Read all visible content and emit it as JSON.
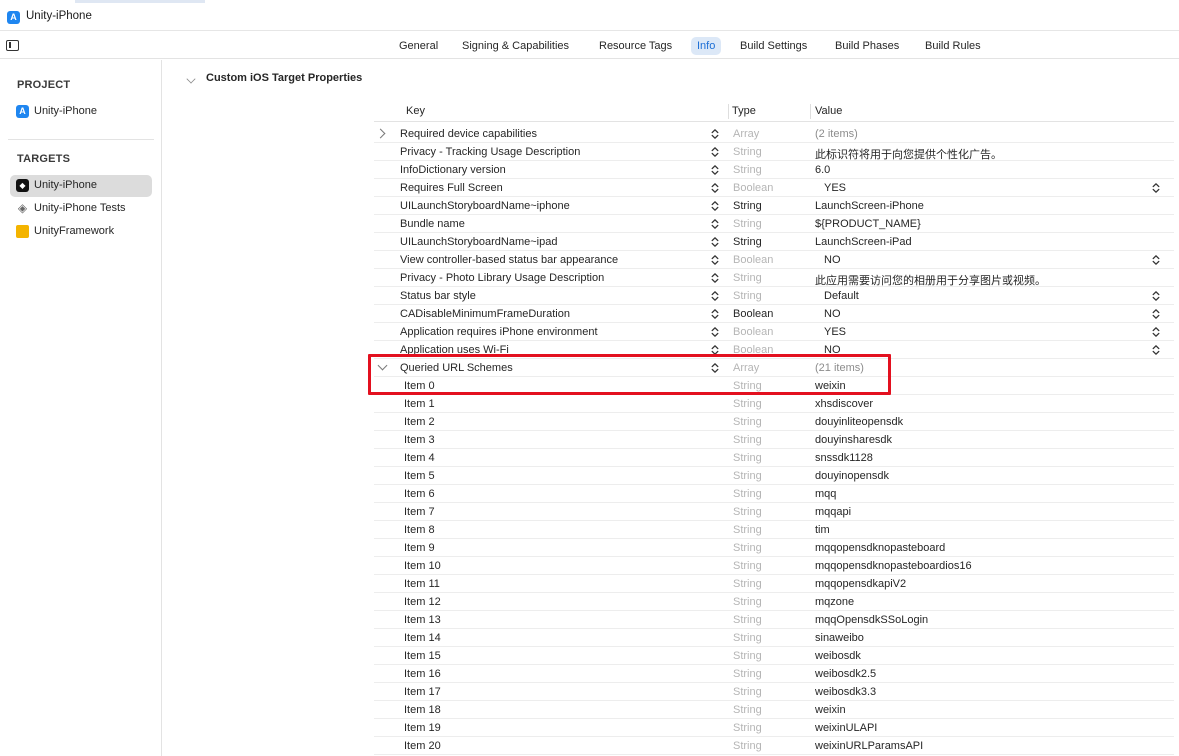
{
  "window": {
    "title": "Unity-iPhone"
  },
  "tabs": [
    {
      "label": "General"
    },
    {
      "label": "Signing & Capabilities"
    },
    {
      "label": "Resource Tags"
    },
    {
      "label": "Info",
      "active": true
    },
    {
      "label": "Build Settings"
    },
    {
      "label": "Build Phases"
    },
    {
      "label": "Build Rules"
    }
  ],
  "sidebar": {
    "project_header": "PROJECT",
    "project_item": "Unity-iPhone",
    "targets_header": "TARGETS",
    "targets": [
      {
        "label": "Unity-iPhone",
        "icon": "unity-app-icon",
        "selected": true
      },
      {
        "label": "Unity-iPhone Tests",
        "icon": "test-bundle-icon"
      },
      {
        "label": "UnityFramework",
        "icon": "framework-icon"
      }
    ]
  },
  "section": {
    "title": "Custom iOS Target Properties"
  },
  "table": {
    "headers": {
      "key": "Key",
      "type": "Type",
      "value": "Value"
    },
    "rows": [
      {
        "key": "Required device capabilities",
        "type": "Array",
        "value": "(2 items)",
        "disclosure": "closed",
        "type_dim": true,
        "value_dim": true
      },
      {
        "key": "Privacy - Tracking Usage Description",
        "type": "String",
        "value": "此标识符将用于向您提供个性化广告。",
        "type_dim": true
      },
      {
        "key": "InfoDictionary version",
        "type": "String",
        "value": "6.0",
        "type_dim": true
      },
      {
        "key": "Requires Full Screen",
        "type": "Boolean",
        "value": "YES",
        "type_dim": true,
        "popup": true
      },
      {
        "key": "UILaunchStoryboardName~iphone",
        "type": "String",
        "value": "LaunchScreen-iPhone",
        "type_dim": false
      },
      {
        "key": "Bundle name",
        "type": "String",
        "value": "${PRODUCT_NAME}",
        "type_dim": true
      },
      {
        "key": "UILaunchStoryboardName~ipad",
        "type": "String",
        "value": "LaunchScreen-iPad",
        "type_dim": false
      },
      {
        "key": "View controller-based status bar appearance",
        "type": "Boolean",
        "value": "NO",
        "type_dim": true,
        "popup": true
      },
      {
        "key": "Privacy - Photo Library Usage Description",
        "type": "String",
        "value": "此应用需要访问您的相册用于分享图片或视频。",
        "type_dim": true
      },
      {
        "key": "Status bar style",
        "type": "String",
        "value": "Default",
        "type_dim": true,
        "popup": true
      },
      {
        "key": "CADisableMinimumFrameDuration",
        "type": "Boolean",
        "value": "NO",
        "type_dim": false,
        "popup": true
      },
      {
        "key": "Application requires iPhone environment",
        "type": "Boolean",
        "value": "YES",
        "type_dim": true,
        "popup": true
      },
      {
        "key": "Application uses Wi-Fi",
        "type": "Boolean",
        "value": "NO",
        "type_dim": true,
        "popup": true
      },
      {
        "key": "Queried URL Schemes",
        "type": "Array",
        "value": "(21 items)",
        "disclosure": "open",
        "type_dim": true,
        "value_dim": true
      },
      {
        "key": "Item 0",
        "type": "String",
        "value": "weixin",
        "child": true,
        "type_dim": true
      },
      {
        "key": "Item 1",
        "type": "String",
        "value": "xhsdiscover",
        "child": true,
        "type_dim": true
      },
      {
        "key": "Item 2",
        "type": "String",
        "value": "douyinliteopensdk",
        "child": true,
        "type_dim": true
      },
      {
        "key": "Item 3",
        "type": "String",
        "value": "douyinsharesdk",
        "child": true,
        "type_dim": true
      },
      {
        "key": "Item 4",
        "type": "String",
        "value": "snssdk1128",
        "child": true,
        "type_dim": true
      },
      {
        "key": "Item 5",
        "type": "String",
        "value": "douyinopensdk",
        "child": true,
        "type_dim": true
      },
      {
        "key": "Item 6",
        "type": "String",
        "value": "mqq",
        "child": true,
        "type_dim": true
      },
      {
        "key": "Item 7",
        "type": "String",
        "value": "mqqapi",
        "child": true,
        "type_dim": true
      },
      {
        "key": "Item 8",
        "type": "String",
        "value": "tim",
        "child": true,
        "type_dim": true
      },
      {
        "key": "Item 9",
        "type": "String",
        "value": "mqqopensdknopasteboard",
        "child": true,
        "type_dim": true
      },
      {
        "key": "Item 10",
        "type": "String",
        "value": "mqqopensdknopasteboardios16",
        "child": true,
        "type_dim": true
      },
      {
        "key": "Item 11",
        "type": "String",
        "value": "mqqopensdkapiV2",
        "child": true,
        "type_dim": true
      },
      {
        "key": "Item 12",
        "type": "String",
        "value": "mqzone",
        "child": true,
        "type_dim": true
      },
      {
        "key": "Item 13",
        "type": "String",
        "value": "mqqOpensdkSSoLogin",
        "child": true,
        "type_dim": true
      },
      {
        "key": "Item 14",
        "type": "String",
        "value": "sinaweibo",
        "child": true,
        "type_dim": true
      },
      {
        "key": "Item 15",
        "type": "String",
        "value": "weibosdk",
        "child": true,
        "type_dim": true
      },
      {
        "key": "Item 16",
        "type": "String",
        "value": "weibosdk2.5",
        "child": true,
        "type_dim": true
      },
      {
        "key": "Item 17",
        "type": "String",
        "value": "weibosdk3.3",
        "child": true,
        "type_dim": true
      },
      {
        "key": "Item 18",
        "type": "String",
        "value": "weixin",
        "child": true,
        "type_dim": true
      },
      {
        "key": "Item 19",
        "type": "String",
        "value": "weixinULAPI",
        "child": true,
        "type_dim": true
      },
      {
        "key": "Item 20",
        "type": "String",
        "value": "weixinURLParamsAPI",
        "child": true,
        "type_dim": true
      }
    ]
  },
  "colors": {
    "accent": "#1d6fd6",
    "tab_active_bg": "#dce8f7",
    "highlight_box": "#e3101f",
    "sidebar_selected": "#dcdcdc"
  }
}
